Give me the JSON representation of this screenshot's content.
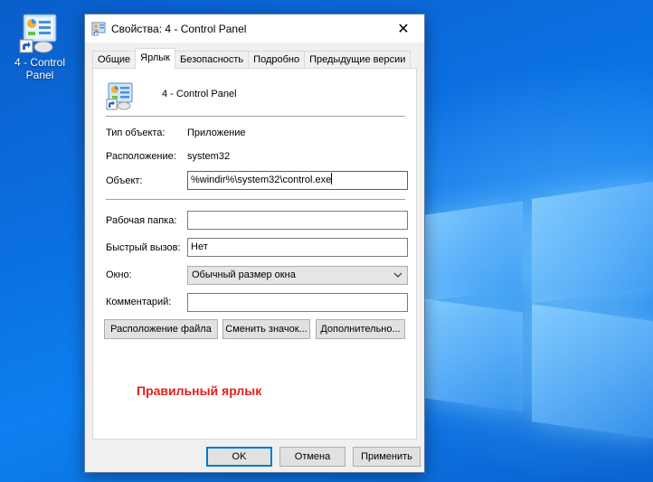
{
  "desktop": {
    "icon_label": "4 - Control Panel"
  },
  "dialog": {
    "title": "Свойства: 4 - Control Panel",
    "close_glyph": "✕",
    "tabs": [
      {
        "label": "Общие"
      },
      {
        "label": "Ярлык",
        "active": true
      },
      {
        "label": "Безопасность"
      },
      {
        "label": "Подробно"
      },
      {
        "label": "Предыдущие версии"
      }
    ],
    "shortcut": {
      "name": "4 - Control Panel",
      "type_label": "Тип объекта:",
      "type_value": "Приложение",
      "location_label": "Расположение:",
      "location_value": "system32",
      "target_label": "Объект:",
      "target_value": "%windir%\\system32\\control.exe",
      "start_in_label": "Рабочая папка:",
      "start_in_value": "",
      "hotkey_label": "Быстрый вызов:",
      "hotkey_value": "Нет",
      "run_label": "Окно:",
      "run_value": "Обычный размер окна",
      "comment_label": "Комментарий:",
      "comment_value": "",
      "open_location_button": "Расположение файла",
      "change_icon_button": "Сменить значок...",
      "advanced_button": "Дополнительно..."
    },
    "annotation": "Правильный ярлык",
    "buttons": {
      "ok": "OK",
      "cancel": "Отмена",
      "apply": "Применить"
    }
  },
  "colors": {
    "accent": "#0078d7",
    "annotation": "#e0201a",
    "desktop": "#0b6fe0"
  },
  "icons": [
    "control-panel-icon",
    "shortcut-arrow-icon",
    "close-icon",
    "chevron-down-icon"
  ]
}
